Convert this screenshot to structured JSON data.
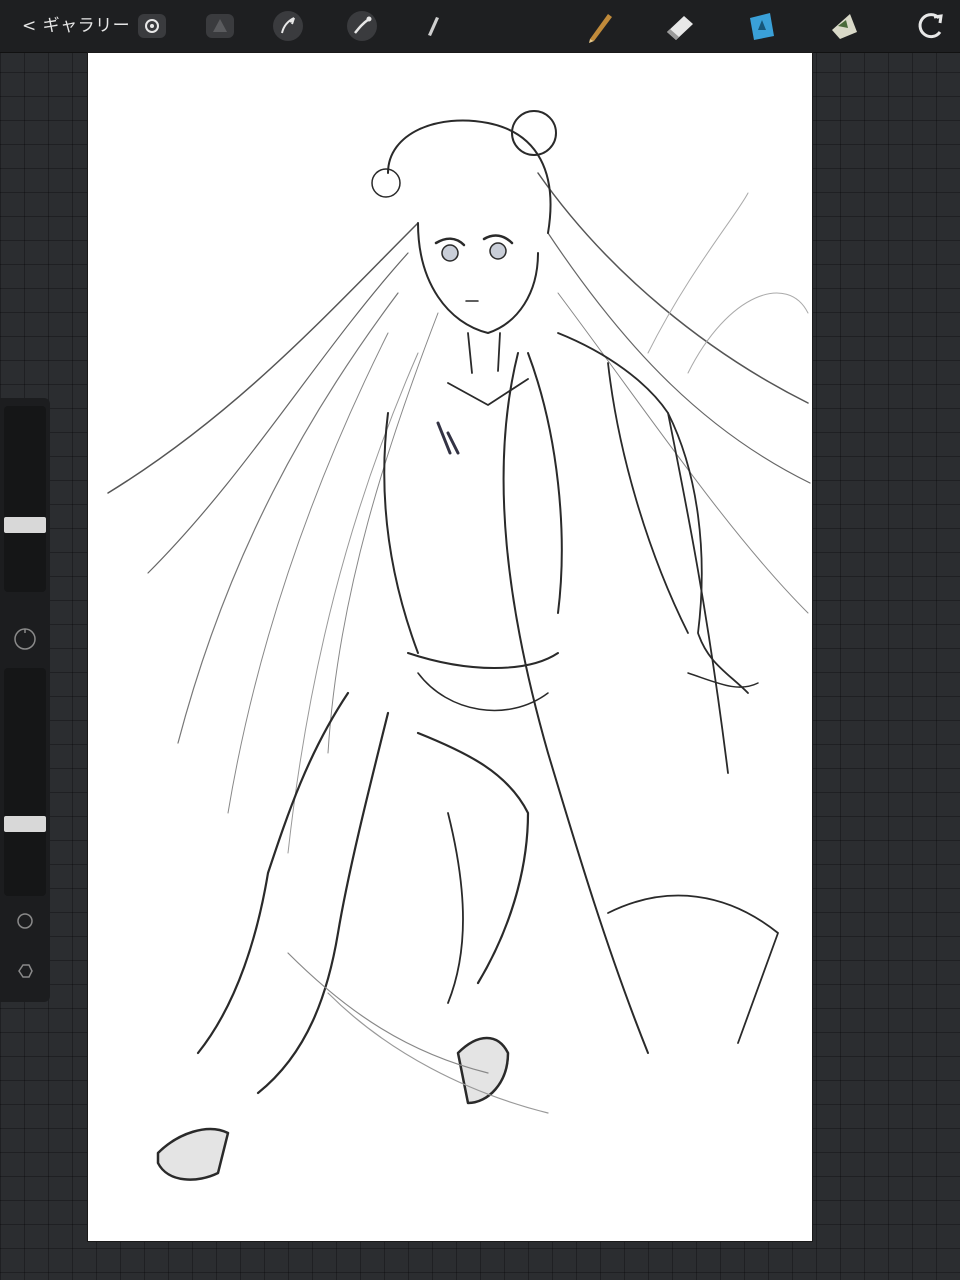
{
  "toolbar": {
    "gallery_label": "< ギャラリー",
    "tools": [
      {
        "name": "actions-icon"
      },
      {
        "name": "adjustments-icon"
      },
      {
        "name": "selection-icon"
      },
      {
        "name": "transform-icon"
      },
      {
        "name": "brush-icon"
      },
      {
        "name": "smudge-icon"
      },
      {
        "name": "eraser-icon"
      },
      {
        "name": "layers-icon"
      },
      {
        "name": "color-icon"
      }
    ],
    "accent_color": "#3aa0d8"
  },
  "sidebar": {
    "brush_size_level": 0.35,
    "opacity_level": 0.3
  }
}
